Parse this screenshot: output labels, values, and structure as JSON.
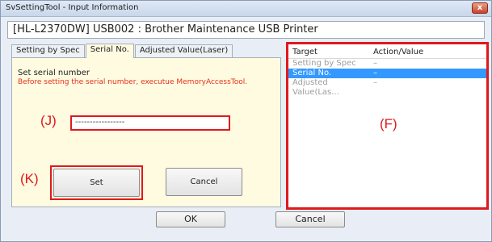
{
  "window": {
    "title": "SvSettingTool - Input Information",
    "close_glyph": "x"
  },
  "device_header": "[HL-L2370DW] USB002 : Brother Maintenance USB Printer",
  "tabs": [
    {
      "label": "Setting by Spec",
      "active": false
    },
    {
      "label": "Serial No.",
      "active": true
    },
    {
      "label": "Adjusted Value(Laser)",
      "active": false
    }
  ],
  "serial_panel": {
    "label": "Set serial number",
    "warning": "Before  setting the serial number, executue MemoryAccessTool.",
    "serial_value": "-----------------",
    "set_label": "Set",
    "cancel_label": "Cancel"
  },
  "callouts": {
    "j": "(J)",
    "k": "(K)",
    "f": "(F)"
  },
  "target_list": {
    "headers": [
      "Target",
      "Action/Value"
    ],
    "rows": [
      {
        "target": "Setting by Spec",
        "value": "–"
      },
      {
        "target": "Serial No.",
        "value": "–"
      },
      {
        "target": "Adjusted Value(Las...",
        "value": "–"
      }
    ],
    "selected_index": 1
  },
  "footer": {
    "ok_label": "OK",
    "cancel_label": "Cancel"
  },
  "colors": {
    "callout_red": "#e0191c",
    "warning_red": "#e5301d",
    "selection_blue": "#3399ff",
    "panel_yellow": "#fffbe0"
  }
}
